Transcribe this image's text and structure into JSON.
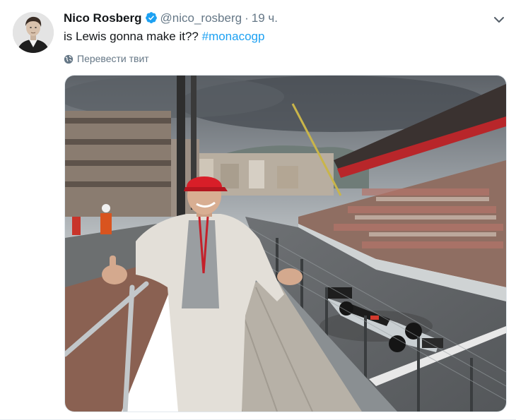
{
  "tweet": {
    "author_name": "Nico Rosberg",
    "handle": "@nico_rosberg",
    "separator": "·",
    "time": "19 ч.",
    "text_main": "is Lewis gonna make it?? ",
    "hashtag": "#monacogp",
    "translate_label": "Перевести твит"
  },
  "colors": {
    "link": "#1da1f2",
    "secondary_text": "#657786",
    "primary_text": "#14171a",
    "verified": "#1da1f2"
  },
  "icons": {
    "verified": "verified-badge-icon",
    "menu": "chevron-down-icon",
    "translate": "globe-icon"
  }
}
